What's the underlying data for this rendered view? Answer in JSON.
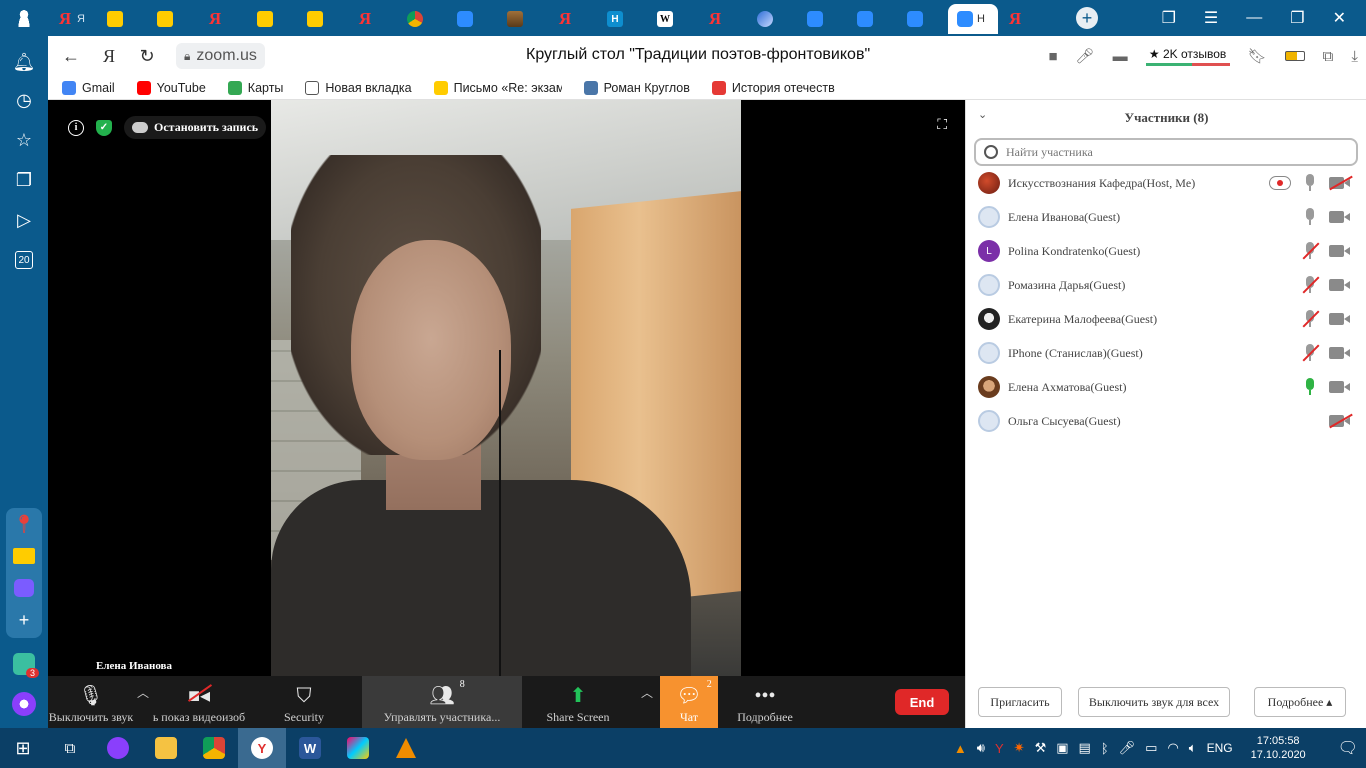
{
  "browser": {
    "tabs": [
      {
        "icon": "yandex-icon",
        "glyph": "Я",
        "text": "Я",
        "active": false
      },
      {
        "icon": "mail-icon",
        "glyph": "",
        "text": "",
        "active": false
      },
      {
        "icon": "mail-icon",
        "glyph": "",
        "text": "",
        "active": false
      },
      {
        "icon": "yandex-icon",
        "glyph": "Я",
        "text": "",
        "active": false
      },
      {
        "icon": "mail-icon",
        "glyph": "",
        "text": "",
        "active": false
      },
      {
        "icon": "mail-icon",
        "glyph": "",
        "text": "",
        "active": false
      },
      {
        "icon": "yandex-icon",
        "glyph": "Я",
        "text": "",
        "active": false
      },
      {
        "icon": "chrome-icon",
        "glyph": "",
        "text": "",
        "active": false
      },
      {
        "icon": "zoom-icon",
        "glyph": "",
        "text": "",
        "active": false
      },
      {
        "icon": "image-icon",
        "glyph": "",
        "text": "",
        "active": false
      },
      {
        "icon": "yandex-icon",
        "glyph": "Я",
        "text": "",
        "active": false
      },
      {
        "icon": "n-icon",
        "glyph": "H",
        "text": "",
        "active": false
      },
      {
        "icon": "wikipedia-icon",
        "glyph": "W",
        "text": "",
        "active": false
      },
      {
        "icon": "yandex-icon",
        "glyph": "Я",
        "text": "",
        "active": false
      },
      {
        "icon": "blue-globe-icon",
        "glyph": "",
        "text": "",
        "active": false
      },
      {
        "icon": "zoom-icon",
        "glyph": "",
        "text": "",
        "active": false
      },
      {
        "icon": "zoom-icon",
        "glyph": "",
        "text": "",
        "active": false
      },
      {
        "icon": "zoom-icon",
        "glyph": "",
        "text": "",
        "active": false
      },
      {
        "icon": "zoom-icon",
        "glyph": "",
        "text": "H",
        "active": true
      },
      {
        "icon": "yandex-icon",
        "glyph": "Я",
        "text": "",
        "active": false
      }
    ],
    "url": "zoom.us",
    "yandex_button": "Я",
    "page_title": "Круглый стол \"Традиции поэтов-фронтовиков\"",
    "reviews": "★ 2K отзывов",
    "bookmarks": [
      {
        "icon": "google-icon",
        "label": "Gmail"
      },
      {
        "icon": "youtube-icon",
        "label": "YouTube"
      },
      {
        "icon": "maps-icon",
        "label": "Карты"
      },
      {
        "icon": "page-icon",
        "label": "Новая вкладка"
      },
      {
        "icon": "mail-icon",
        "label": "Письмо «Re: экзам"
      },
      {
        "icon": "vk-icon",
        "label": "Роман Круглов"
      },
      {
        "icon": "history-icon",
        "label": "История отечеств"
      }
    ]
  },
  "sidebar": {
    "badge_label": "20",
    "notification_count": "3"
  },
  "meeting": {
    "stop_recording": "Остановить запись",
    "active_speaker": "Елена Иванова",
    "toolbar": {
      "mute": "Выключить звук",
      "video": "ь показ видеоизоб",
      "security": "Security",
      "participants": "Управлять участника...",
      "participants_count": "8",
      "share": "Share Screen",
      "chat": "Чат",
      "chat_count": "2",
      "more": "Подробнее",
      "end": "End"
    }
  },
  "participants_panel": {
    "title": "Участники (8)",
    "search_placeholder": "Найти участника",
    "list": [
      {
        "name": "Искусствознания Кафедра(Host, Me)",
        "avatar": "av-red",
        "letter": "",
        "recording": true,
        "mic": "on",
        "cam": "off"
      },
      {
        "name": "Елена Иванова(Guest)",
        "avatar": "av-default",
        "letter": "",
        "recording": false,
        "mic": "on",
        "cam": "on"
      },
      {
        "name": "Polina Kondratenko(Guest)",
        "avatar": "av-purple",
        "letter": "L",
        "recording": false,
        "mic": "muted",
        "cam": "on"
      },
      {
        "name": "Ромазина Дарья(Guest)",
        "avatar": "av-default",
        "letter": "",
        "recording": false,
        "mic": "muted",
        "cam": "on"
      },
      {
        "name": "Екатерина Малофеева(Guest)",
        "avatar": "av-bw",
        "letter": "",
        "recording": false,
        "mic": "muted",
        "cam": "on"
      },
      {
        "name": "IPhone (Станислав)(Guest)",
        "avatar": "av-default",
        "letter": "",
        "recording": false,
        "mic": "muted",
        "cam": "on"
      },
      {
        "name": "Елена Ахматова(Guest)",
        "avatar": "av-photo",
        "letter": "",
        "recording": false,
        "mic": "speaking",
        "cam": "on"
      },
      {
        "name": "Ольга Сысуева(Guest)",
        "avatar": "av-default",
        "letter": "",
        "recording": false,
        "mic": "none",
        "cam": "off"
      }
    ],
    "invite": "Пригласить",
    "mute_all": "Выключить звук для всех",
    "more": "Подробнее ▴"
  },
  "taskbar": {
    "language": "ENG",
    "time": "17:05:58",
    "date": "17.10.2020"
  },
  "colors": {
    "browser_chrome": "#0b5a8c",
    "taskbar": "#0b3f66",
    "end_button": "#e02828",
    "chat_active": "#f7922f",
    "speaking_mic": "#2fb344"
  }
}
